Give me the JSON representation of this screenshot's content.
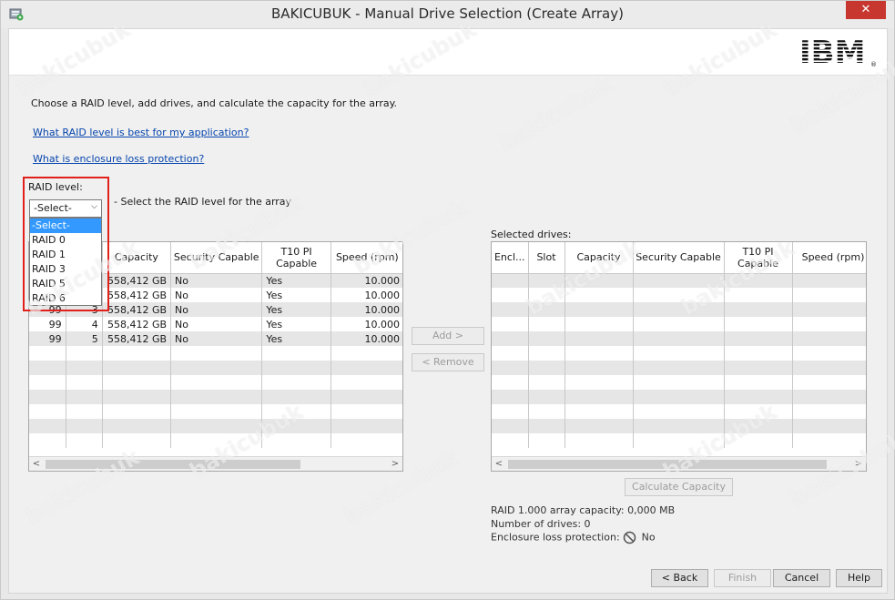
{
  "window": {
    "title": "BAKICUBUK - Manual Drive Selection (Create Array)",
    "close_label": "✕"
  },
  "logo": {
    "text": "IBM",
    "mark": "®"
  },
  "intro": "Choose a RAID level, add drives, and calculate the capacity for the array.",
  "links": {
    "raid_best": "What RAID level is best for my application?",
    "enclosure": "What is enclosure loss protection?"
  },
  "raid": {
    "label": "RAID level:",
    "selected": "-Select-",
    "hint": "- Select the RAID level for the array",
    "options": [
      "-Select-",
      "RAID 0",
      "RAID 1",
      "RAID 3",
      "RAID 5",
      "RAID 6"
    ]
  },
  "available_grid": {
    "header_fragment": "s",
    "columns": [
      "",
      "",
      "Capacity",
      "Security Capable",
      "T10 PI Capable",
      "Speed (rpm)"
    ],
    "rows": [
      {
        "enclosure": "",
        "slot": "",
        "capacity": "558,412 GB",
        "security": "No",
        "t10": "Yes",
        "speed": "10.000"
      },
      {
        "enclosure": "",
        "slot": "",
        "capacity": "558,412 GB",
        "security": "No",
        "t10": "Yes",
        "speed": "10.000"
      },
      {
        "enclosure": "99",
        "slot": "3",
        "capacity": "558,412 GB",
        "security": "No",
        "t10": "Yes",
        "speed": "10.000"
      },
      {
        "enclosure": "99",
        "slot": "4",
        "capacity": "558,412 GB",
        "security": "No",
        "t10": "Yes",
        "speed": "10.000"
      },
      {
        "enclosure": "99",
        "slot": "5",
        "capacity": "558,412 GB",
        "security": "No",
        "t10": "Yes",
        "speed": "10.000"
      }
    ]
  },
  "buttons": {
    "add": "Add >",
    "remove": "< Remove",
    "calculate": "Calculate Capacity",
    "back": "< Back",
    "finish": "Finish",
    "cancel": "Cancel",
    "help": "Help"
  },
  "selected_grid": {
    "label": "Selected drives:",
    "columns": [
      "Encl...",
      "Slot",
      "Capacity",
      "Security Capable",
      "T10 PI Capable",
      "Speed (rpm)"
    ]
  },
  "summary": {
    "capacity": "RAID 1.000 array capacity: 0,000 MB",
    "drive_count": "Number of drives: 0",
    "enclosure_label": "Enclosure loss protection:",
    "enclosure_value": "No"
  },
  "scroll_arrows": {
    "left": "<",
    "right": ">"
  },
  "watermark": "bakicubuk",
  "colors": {
    "highlight": "#e0201b",
    "link": "#0645ad",
    "selection": "#3399ff",
    "close": "#c7372f"
  }
}
